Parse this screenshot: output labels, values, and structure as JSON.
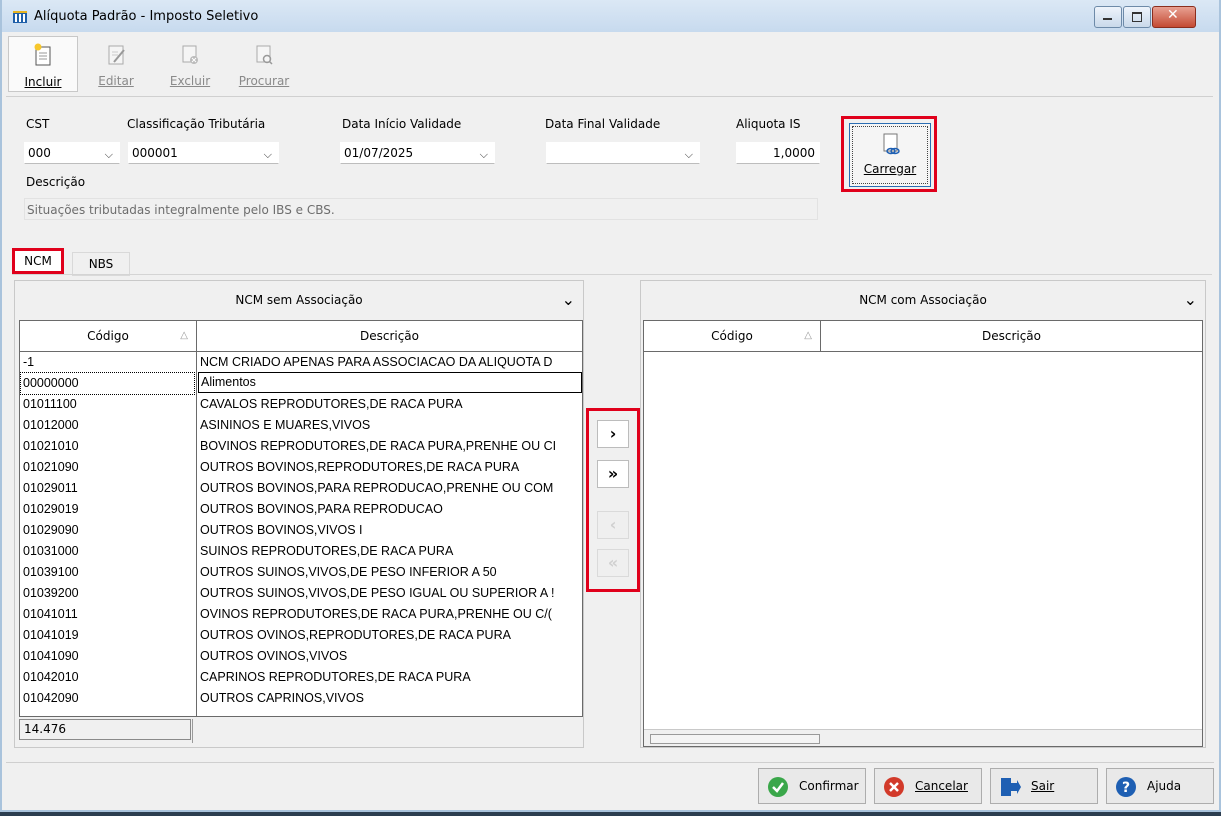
{
  "window": {
    "title": "Alíquota Padrão - Imposto Seletivo"
  },
  "toolbar": {
    "incluir": "Incluir",
    "editar": "Editar",
    "excluir": "Excluir",
    "procurar": "Procurar"
  },
  "form": {
    "cst_label": "CST",
    "cst_value": "000",
    "classificacao_label": "Classificação Tributária",
    "classificacao_value": "000001",
    "data_inicio_label": "Data Início Validade",
    "data_inicio_value": "01/07/2025",
    "data_final_label": "Data Final Validade",
    "data_final_value": "",
    "aliquota_label": "Aliquota IS",
    "aliquota_value": "1,0000",
    "carregar_label": "Carregar",
    "descricao_label": "Descrição",
    "descricao_value": "Situações tributadas integralmente pelo IBS e CBS."
  },
  "tabs": {
    "ncm": "NCM",
    "nbs": "NBS"
  },
  "left_panel": {
    "title": "NCM sem Associação",
    "col_codigo": "Código",
    "col_descricao": "Descrição",
    "rows": [
      {
        "codigo": "-1",
        "descricao": "NCM CRIADO APENAS PARA ASSOCIACAO DA ALIQUOTA D"
      },
      {
        "codigo": "00000000",
        "descricao": "Alimentos"
      },
      {
        "codigo": "01011100",
        "descricao": "CAVALOS REPRODUTORES,DE RACA PURA"
      },
      {
        "codigo": "01012000",
        "descricao": "ASININOS E MUARES,VIVOS"
      },
      {
        "codigo": "01021010",
        "descricao": "BOVINOS REPRODUTORES,DE RACA PURA,PRENHE OU CI"
      },
      {
        "codigo": "01021090",
        "descricao": "OUTROS BOVINOS,REPRODUTORES,DE RACA PURA"
      },
      {
        "codigo": "01029011",
        "descricao": "OUTROS BOVINOS,PARA REPRODUCAO,PRENHE OU COM"
      },
      {
        "codigo": "01029019",
        "descricao": "OUTROS BOVINOS,PARA REPRODUCAO"
      },
      {
        "codigo": "01029090",
        "descricao": "OUTROS BOVINOS,VIVOS I"
      },
      {
        "codigo": "01031000",
        "descricao": "SUINOS REPRODUTORES,DE RACA PURA"
      },
      {
        "codigo": "01039100",
        "descricao": "OUTROS SUINOS,VIVOS,DE PESO INFERIOR A 50"
      },
      {
        "codigo": "01039200",
        "descricao": "OUTROS SUINOS,VIVOS,DE PESO IGUAL OU SUPERIOR A !"
      },
      {
        "codigo": "01041011",
        "descricao": "OVINOS REPRODUTORES,DE RACA PURA,PRENHE OU C/("
      },
      {
        "codigo": "01041019",
        "descricao": "OUTROS OVINOS,REPRODUTORES,DE RACA PURA"
      },
      {
        "codigo": "01041090",
        "descricao": "OUTROS OVINOS,VIVOS"
      },
      {
        "codigo": "01042010",
        "descricao": "CAPRINOS REPRODUTORES,DE RACA PURA"
      },
      {
        "codigo": "01042090",
        "descricao": "OUTROS CAPRINOS,VIVOS"
      }
    ],
    "count": "14.476"
  },
  "right_panel": {
    "title": "NCM com Associação",
    "col_codigo": "Código",
    "col_descricao": "Descrição"
  },
  "move_buttons": {
    "add_one": "›",
    "add_all": "»",
    "remove_one": "‹",
    "remove_all": "«"
  },
  "footer": {
    "confirmar": "Confirmar",
    "cancelar": "Cancelar",
    "sair": "Sair",
    "ajuda": "Ajuda"
  },
  "colors": {
    "highlight": "#e0001b",
    "confirm": "#3aa74a",
    "cancel": "#d23a2a",
    "help": "#1e5fb3"
  }
}
